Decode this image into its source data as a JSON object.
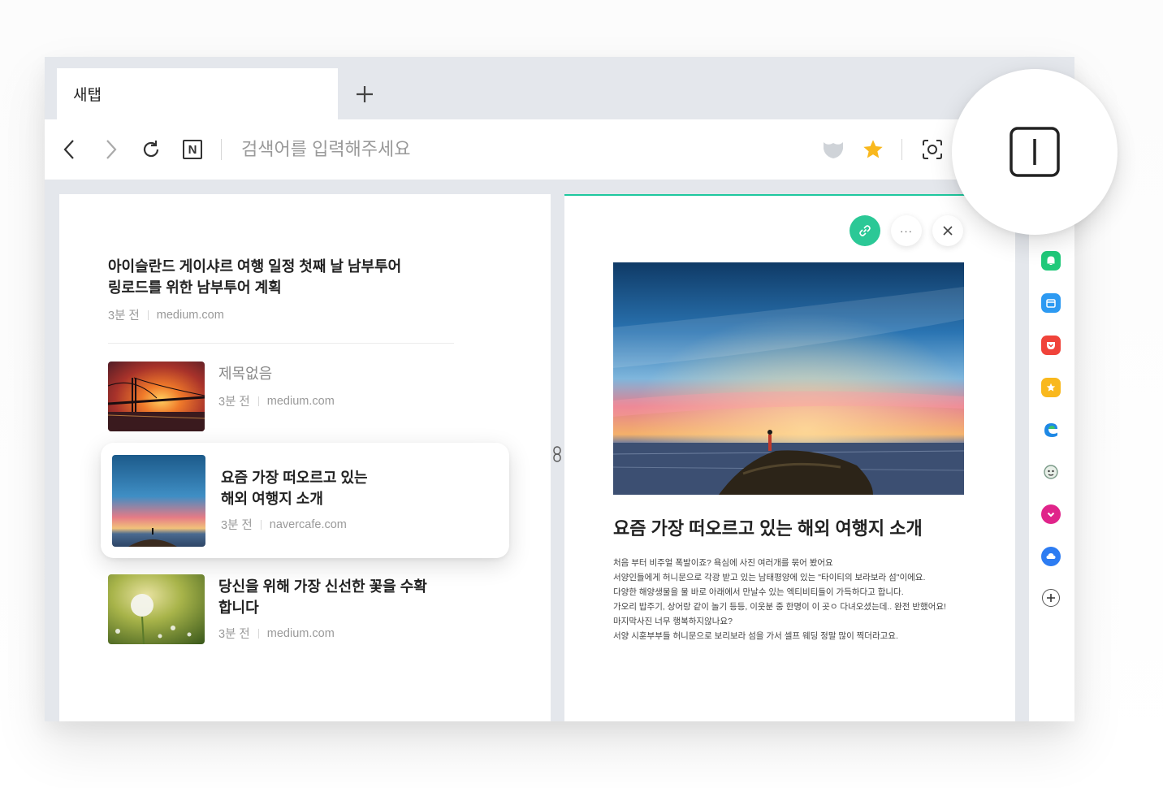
{
  "browser": {
    "tab_title": "새탭",
    "new_tab_icon": "plus-icon",
    "address_placeholder": "검색어를 입력해주세요",
    "logo_text": "N"
  },
  "feed": {
    "items": [
      {
        "title_line1": "아이슬란드 게이샤르 여행 일정 첫째 날 남부투어",
        "title_line2": "링로드를 위한 남부투어 계획",
        "time": "3분 전",
        "source": "medium.com"
      },
      {
        "title": "제목없음",
        "time": "3분 전",
        "source": "medium.com"
      },
      {
        "title_line1": "요즘 가장 떠오르고 있는",
        "title_line2": "해외 여행지 소개",
        "time": "3분 전",
        "source": "navercafe.com"
      },
      {
        "title_line1": "당신을 위해 가장 신선한 꽃을 수확",
        "title_line2": "합니다",
        "time": "3분 전",
        "source": "medium.com"
      }
    ]
  },
  "article": {
    "title": "요즘 가장 떠오르고 있는 해외 여행지 소개",
    "more_label": "···",
    "body": [
      "처음 부터 비주얼 폭발이죠? 욕심에 사진 여러개를 묶어 봤어요",
      "서양인들에게 허니문으로 각광 받고 있는 남태평양에 있는 \"타이티의 보라보라 섬\"이에요.",
      "다양한 해양생물을 물 바로 아래에서 만날수 있는 엑티비티들이 가득하다고 합니다.",
      "가오리 밥주기, 상어랑 같이 놀기 등등, 이웃분 중 한명이 이 곳ㅇ 다녀오셨는데.. 완전 반했어요!",
      "마지막사진 너무 행복하지않나요?",
      "서양 시훈부부들 허니문으로 보리보라 섬을 가서 셀프 웨딩 정말 많이 찍더라고요."
    ]
  },
  "colors": {
    "accent_green": "#2bc896",
    "star": "#f9b81d"
  }
}
